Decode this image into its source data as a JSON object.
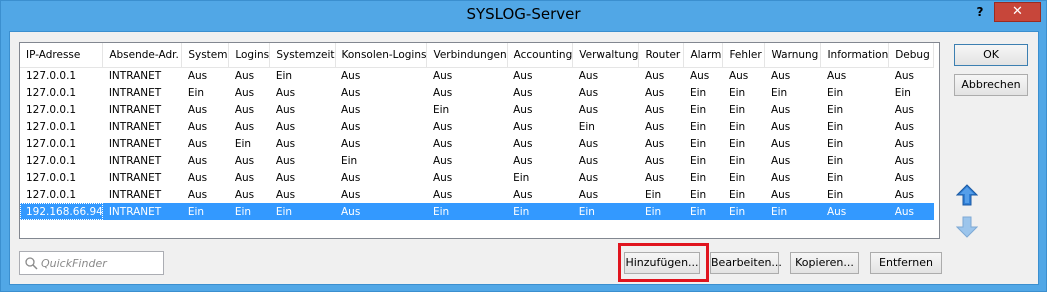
{
  "window": {
    "title": "SYSLOG-Server",
    "help_label": "?",
    "close_label": "✕"
  },
  "columns": [
    "IP-Adresse",
    "Absende-Adr.",
    "System",
    "Logins",
    "Systemzeit",
    "Konsolen-Logins",
    "Verbindungen",
    "Accounting",
    "Verwaltung",
    "Router",
    "Alarm",
    "Fehler",
    "Warnung",
    "Information",
    "Debug"
  ],
  "rows": [
    [
      "127.0.0.1",
      "INTRANET",
      "Aus",
      "Aus",
      "Ein",
      "Aus",
      "Aus",
      "Aus",
      "Aus",
      "Aus",
      "Aus",
      "Aus",
      "Aus",
      "Aus",
      "Aus"
    ],
    [
      "127.0.0.1",
      "INTRANET",
      "Ein",
      "Aus",
      "Aus",
      "Aus",
      "Aus",
      "Aus",
      "Aus",
      "Aus",
      "Ein",
      "Ein",
      "Ein",
      "Ein",
      "Ein"
    ],
    [
      "127.0.0.1",
      "INTRANET",
      "Aus",
      "Aus",
      "Aus",
      "Aus",
      "Ein",
      "Aus",
      "Aus",
      "Aus",
      "Ein",
      "Ein",
      "Aus",
      "Ein",
      "Aus"
    ],
    [
      "127.0.0.1",
      "INTRANET",
      "Aus",
      "Aus",
      "Aus",
      "Aus",
      "Aus",
      "Aus",
      "Ein",
      "Aus",
      "Ein",
      "Ein",
      "Aus",
      "Ein",
      "Aus"
    ],
    [
      "127.0.0.1",
      "INTRANET",
      "Aus",
      "Ein",
      "Aus",
      "Aus",
      "Aus",
      "Aus",
      "Aus",
      "Aus",
      "Ein",
      "Ein",
      "Aus",
      "Ein",
      "Aus"
    ],
    [
      "127.0.0.1",
      "INTRANET",
      "Aus",
      "Aus",
      "Aus",
      "Ein",
      "Aus",
      "Aus",
      "Aus",
      "Aus",
      "Ein",
      "Ein",
      "Aus",
      "Ein",
      "Aus"
    ],
    [
      "127.0.0.1",
      "INTRANET",
      "Aus",
      "Aus",
      "Aus",
      "Aus",
      "Aus",
      "Ein",
      "Aus",
      "Aus",
      "Ein",
      "Ein",
      "Aus",
      "Ein",
      "Aus"
    ],
    [
      "127.0.0.1",
      "INTRANET",
      "Aus",
      "Aus",
      "Aus",
      "Aus",
      "Aus",
      "Aus",
      "Aus",
      "Ein",
      "Ein",
      "Ein",
      "Aus",
      "Ein",
      "Aus"
    ],
    [
      "192.168.66.94",
      "INTRANET",
      "Ein",
      "Ein",
      "Ein",
      "Aus",
      "Ein",
      "Ein",
      "Ein",
      "Ein",
      "Ein",
      "Ein",
      "Ein",
      "Aus",
      "Aus"
    ]
  ],
  "selected_row": 8,
  "buttons": {
    "ok": "OK",
    "cancel": "Abbrechen",
    "add": "Hinzufügen...",
    "edit": "Bearbeiten...",
    "copy": "Kopieren...",
    "remove": "Entfernen"
  },
  "quickfinder": {
    "placeholder": "QuickFinder"
  },
  "icons": {
    "move_up": "arrow-up-icon",
    "move_down": "arrow-down-icon",
    "search": "search-icon"
  },
  "colors": {
    "title_bar": "#51a7e6",
    "selection": "#3399ff",
    "highlight": "#e0141e",
    "close_button": "#c7463a"
  }
}
